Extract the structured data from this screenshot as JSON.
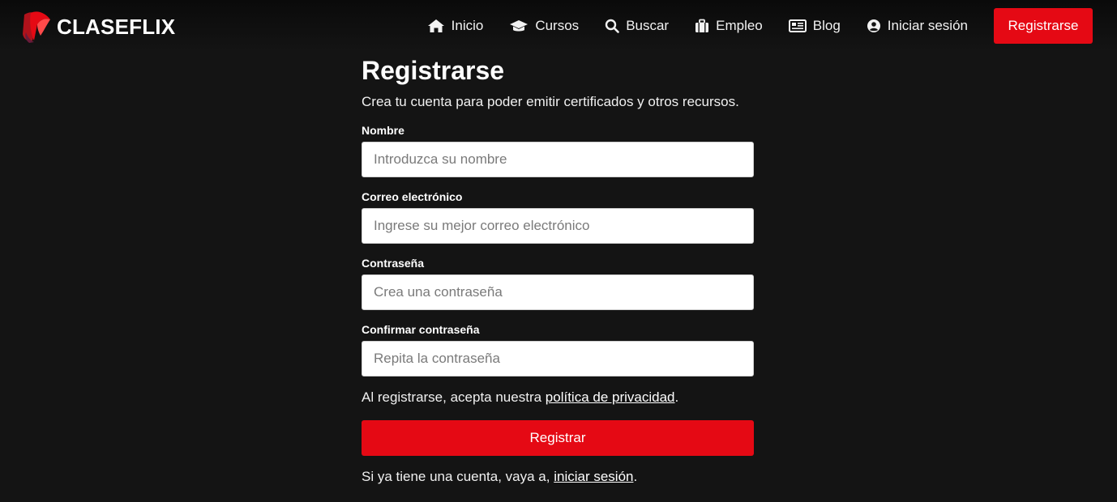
{
  "brand": {
    "name": "CLASEFLIX",
    "logo_icon": "claseflix-logo",
    "accent_color": "#e50914"
  },
  "nav": {
    "items": [
      {
        "label": "Inicio",
        "icon": "home-icon"
      },
      {
        "label": "Cursos",
        "icon": "graduation-cap-icon"
      },
      {
        "label": "Buscar",
        "icon": "search-icon"
      },
      {
        "label": "Empleo",
        "icon": "briefcase-icon"
      },
      {
        "label": "Blog",
        "icon": "newspaper-icon"
      },
      {
        "label": "Iniciar sesión",
        "icon": "user-circle-icon"
      }
    ],
    "register_label": "Registrarse"
  },
  "form": {
    "title": "Registrarse",
    "subtitle": "Crea tu cuenta para poder emitir certificados y otros recursos.",
    "fields": [
      {
        "label": "Nombre",
        "placeholder": "Introduzca su nombre",
        "value": ""
      },
      {
        "label": "Correo electrónico",
        "placeholder": "Ingrese su mejor correo electrónico",
        "value": ""
      },
      {
        "label": "Contraseña",
        "placeholder": "Crea una contraseña",
        "value": ""
      },
      {
        "label": "Confirmar contraseña",
        "placeholder": "Repita la contraseña",
        "value": ""
      }
    ],
    "privacy_prefix": "Al registrarse, acepta nuestra ",
    "privacy_link": "política de privacidad",
    "privacy_suffix": ".",
    "submit_label": "Registrar",
    "login_prefix": "Si ya tiene una cuenta, vaya a, ",
    "login_link": "iniciar sesión",
    "login_suffix": "."
  }
}
